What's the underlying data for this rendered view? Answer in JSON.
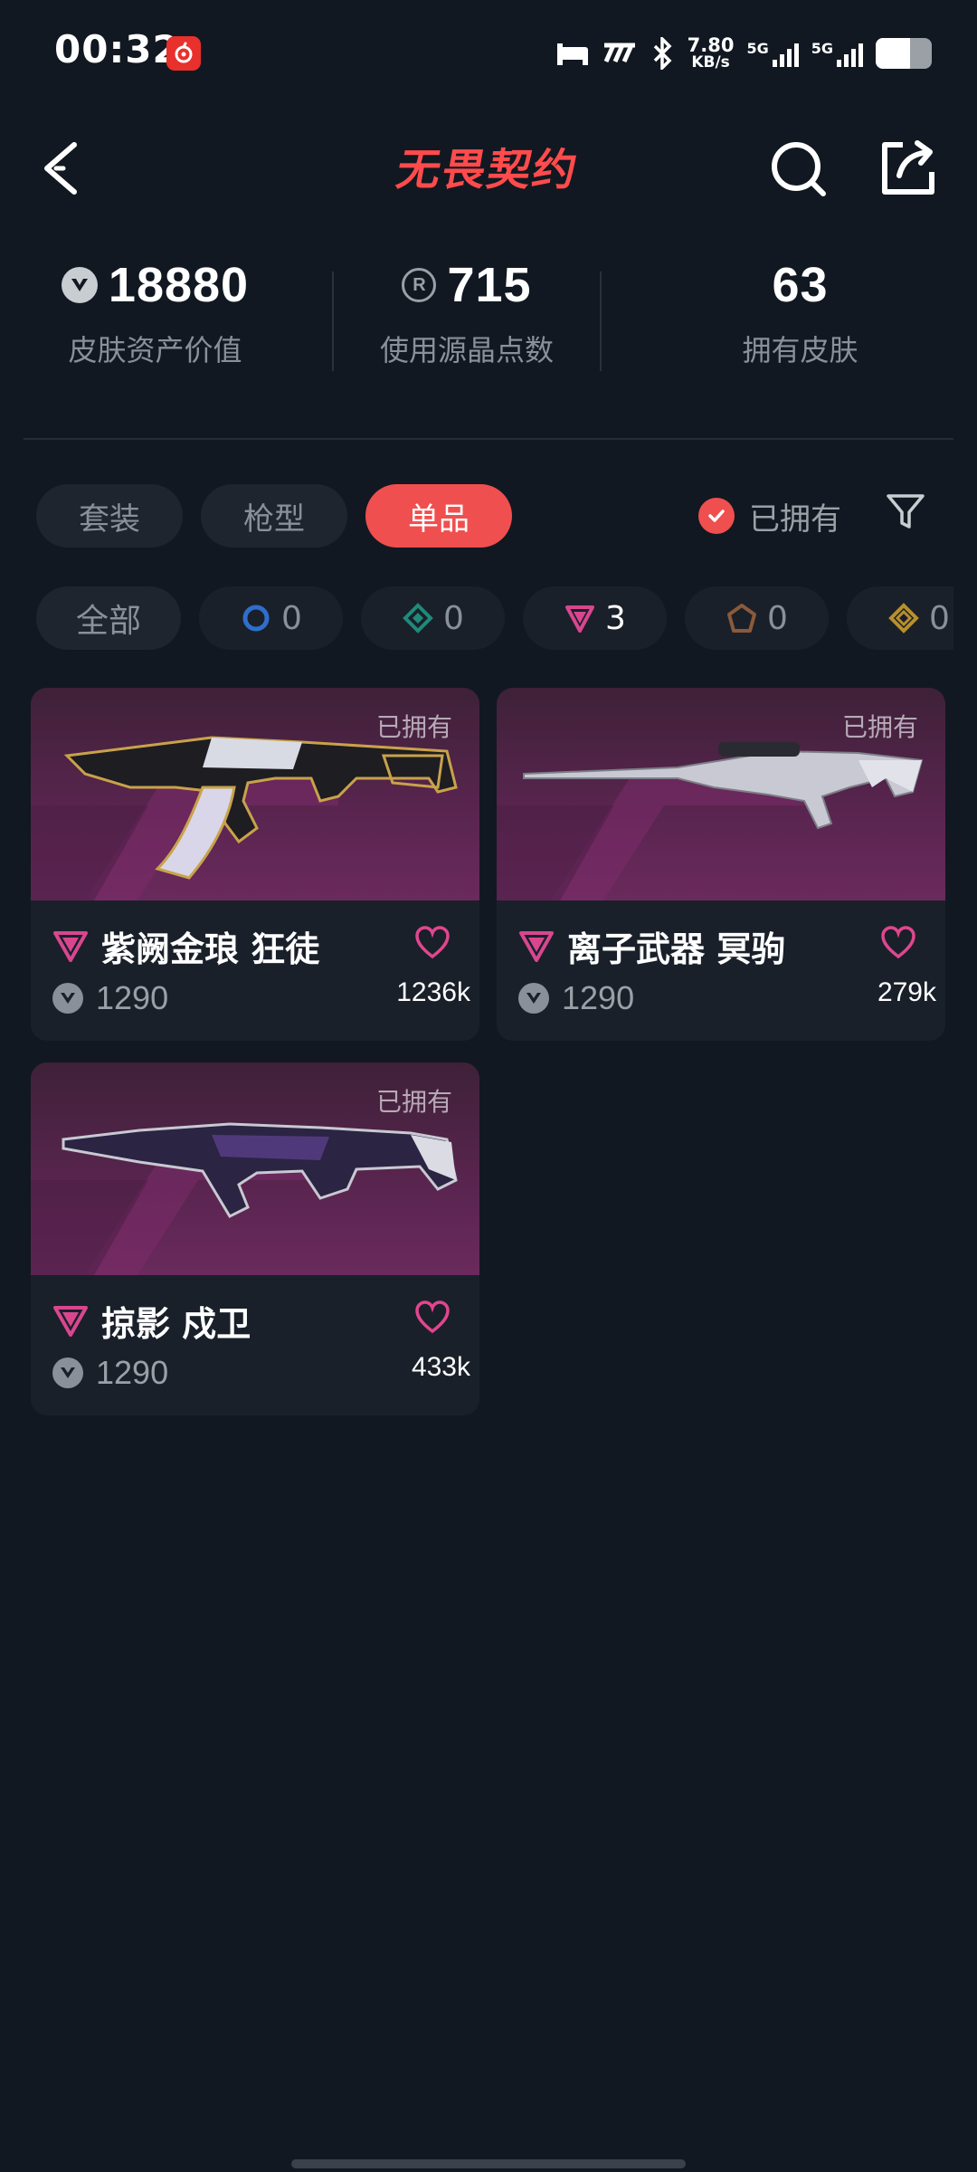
{
  "status": {
    "time": "00:32",
    "speed_value": "7.80",
    "speed_unit": "KB/s",
    "net1": "5G",
    "net2": "5G",
    "battery_level": 0.62
  },
  "header": {
    "brand": "无畏契约"
  },
  "stats": [
    {
      "value": "18880",
      "label": "皮肤资产价值"
    },
    {
      "value": "715",
      "label": "使用源晶点数"
    },
    {
      "value": "63",
      "label": "拥有皮肤"
    }
  ],
  "tabs": [
    {
      "label": "套装"
    },
    {
      "label": "枪型"
    },
    {
      "label": "单品"
    }
  ],
  "owned_filter": {
    "label": "已拥有",
    "checked": true
  },
  "chips": [
    {
      "label": "全部"
    },
    {
      "count": "0",
      "color": "#2f6fcc"
    },
    {
      "count": "0",
      "color": "#1f8a7a"
    },
    {
      "count": "3",
      "color": "#d9468f"
    },
    {
      "count": "0",
      "color": "#8a5a3a"
    },
    {
      "count": "0",
      "color": "#b8902a"
    }
  ],
  "cards": [
    {
      "owned": "已拥有",
      "name": "紫阙金琅 狂徒",
      "price": "1290",
      "likes": "1236k"
    },
    {
      "owned": "已拥有",
      "name": "离子武器 冥驹",
      "price": "1290",
      "likes": "279k"
    },
    {
      "owned": "已拥有",
      "name": "掠影 戍卫",
      "price": "1290",
      "likes": "433k"
    }
  ],
  "colors": {
    "accent": "#f04f4f",
    "background": "#111821",
    "rarity_pink": "#d9468f"
  }
}
